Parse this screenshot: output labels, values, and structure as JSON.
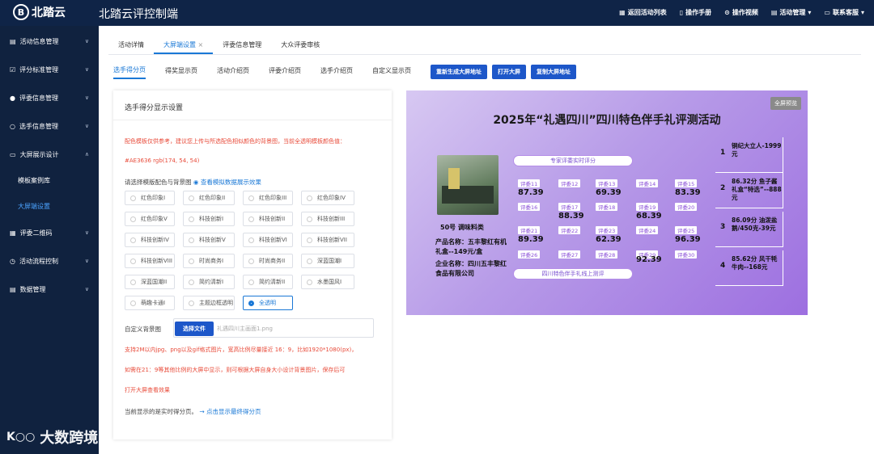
{
  "header": {
    "logo_text": "北踏云",
    "app_title": "北踏云评控制端",
    "menu": [
      {
        "icon": "grid-icon",
        "label": "返回活动列表"
      },
      {
        "icon": "book-icon",
        "label": "操作手册"
      },
      {
        "icon": "play-icon",
        "label": "操作视频"
      },
      {
        "icon": "calendar-icon",
        "label": "活动管理"
      },
      {
        "icon": "chat-icon",
        "label": "联系客服"
      }
    ]
  },
  "sidebar": {
    "items": [
      {
        "label": "活动信息管理",
        "icon": "doc-icon"
      },
      {
        "label": "评分标准管理",
        "icon": "check-square-icon"
      },
      {
        "label": "评委信息管理",
        "icon": "user-icon"
      },
      {
        "label": "选手信息管理",
        "icon": "user-outline-icon"
      },
      {
        "label": "大屏展示设计",
        "icon": "monitor-icon"
      },
      {
        "label": "模板案例库",
        "sub": true
      },
      {
        "label": "大屏端设置",
        "sub": true,
        "active": true
      },
      {
        "label": "评委二维码",
        "icon": "qrcode-icon"
      },
      {
        "label": "活动流程控制",
        "icon": "clock-icon"
      },
      {
        "label": "数据管理",
        "icon": "calendar-icon"
      }
    ]
  },
  "tabs_top": [
    {
      "label": "活动详情"
    },
    {
      "label": "大屏端设置",
      "active": true,
      "closable": true
    },
    {
      "label": "评委信息管理"
    },
    {
      "label": "大众评委审核"
    }
  ],
  "tabs_sub": [
    {
      "label": "选手得分页",
      "active": true
    },
    {
      "label": "得奖显示页"
    },
    {
      "label": "活动介绍页"
    },
    {
      "label": "评委介绍页"
    },
    {
      "label": "选手介绍页"
    },
    {
      "label": "自定义显示页"
    }
  ],
  "action_buttons": [
    "重新生成大屏地址",
    "打开大屏",
    "复制大屏地址"
  ],
  "panel": {
    "title": "选手得分显示设置",
    "color_note": "配色模板仅供参考，建议您上传与所选配色相似颜色的背景图，当前全透明模板颜色值：",
    "color_value": "#AE3636   rgb(174, 54, 54)",
    "select_label": "请选择模版配色与背景图",
    "view_link": "查看模拟数据展示效果",
    "templates": [
      [
        "红色印象I",
        "红色印象II",
        "红色印象III",
        "红色印象IV"
      ],
      [
        "红色印象V",
        "科技创新I",
        "科技创新II",
        "科技创新III"
      ],
      [
        "科技创新IV",
        "科技创新V",
        "科技创新VI",
        "科技创新VII"
      ],
      [
        "科技创新VIII",
        "时尚商务I",
        "时尚商务II",
        "深蓝国潮I"
      ],
      [
        "深蓝国潮II",
        "简约清新I",
        "简约清新II",
        "水墨国风I"
      ],
      [
        "萌趣卡通I",
        "主题边框透明",
        "全透明"
      ]
    ],
    "selected_template": "全透明",
    "custom_bg_label": "自定义背景图",
    "file_button": "选择文件",
    "file_placeholder": "礼遇四川主画面1.png",
    "hint1": "支持2M以内jpg、png以及gif格式图片，宽高比例尽量接近 16：9，比如1920*1080(px)，",
    "hint2": "如需在21：9等其他比例的大屏中显示，则可根据大屏自身大小设计背景图片，保存后可",
    "hint3": "打开大屏查看效果",
    "current_label": "当前显示的是实时得分页。",
    "switch_link": "点击显示最终得分页"
  },
  "preview": {
    "fullscreen_btn": "全屏预览",
    "title": "2025年“礼遇四川”四川特色伴手礼评测活动",
    "pill_top": "专家评委实时评分",
    "pill_bottom": "四川特色伴手礼线上测评",
    "contestant": "50号    调味料类",
    "product": "产品名称：五丰黎红有机礼盒--149元/盒",
    "company": "企业名称：四川五丰黎红食品有限公司",
    "judges": [
      {
        "label": "评委11",
        "value": "87.39"
      },
      {
        "label": "评委12",
        "value": ""
      },
      {
        "label": "评委13",
        "value": "69.39"
      },
      {
        "label": "评委14",
        "value": ""
      },
      {
        "label": "评委15",
        "value": "83.39"
      },
      {
        "label": "评委16",
        "value": ""
      },
      {
        "label": "评委17",
        "value": "88.39"
      },
      {
        "label": "评委18",
        "value": ""
      },
      {
        "label": "评委19",
        "value": "68.39"
      },
      {
        "label": "评委20",
        "value": ""
      },
      {
        "label": "评委21",
        "value": "89.39"
      },
      {
        "label": "评委22",
        "value": ""
      },
      {
        "label": "评委23",
        "value": "62.39"
      },
      {
        "label": "评委24",
        "value": ""
      },
      {
        "label": "评委25",
        "value": "96.39"
      },
      {
        "label": "评委26",
        "value": ""
      },
      {
        "label": "评委27",
        "value": ""
      },
      {
        "label": "评委28",
        "value": ""
      },
      {
        "label": "评委29",
        "value": "92.39"
      },
      {
        "label": "评委30",
        "value": ""
      }
    ],
    "ranking": [
      {
        "num": "1",
        "text": "铜纪大立人-1999元"
      },
      {
        "num": "2",
        "text": "86.32分 鱼子酱礼盒“特选”--888元"
      },
      {
        "num": "3",
        "text": "86.09分 油泼盐鹅/450克-39元"
      },
      {
        "num": "4",
        "text": "85.62分 风干牦牛肉--168元"
      }
    ]
  },
  "watermark": "大数跨境"
}
